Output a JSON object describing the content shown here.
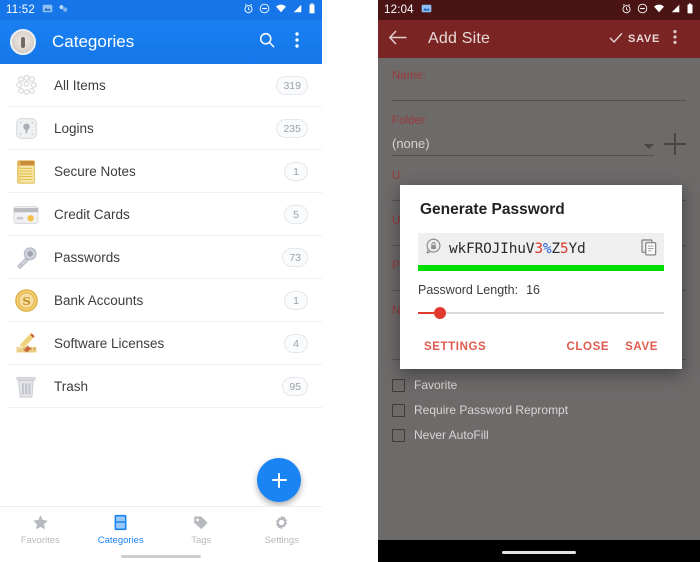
{
  "left_phone": {
    "status_bar": {
      "time": "11:52",
      "left_icons": [
        "screenshot-icon",
        "sync-icon"
      ],
      "right_icons": [
        "alarm-icon",
        "do-not-disturb-icon",
        "wifi-icon",
        "signal-icon",
        "battery-icon"
      ],
      "background": "#1675e8"
    },
    "app_bar": {
      "logo": "onepassword-logo-icon",
      "title": "Categories",
      "search_icon": "search-icon",
      "overflow_icon": "more-vertical-icon",
      "background": "#1a7cf0"
    },
    "categories": [
      {
        "icon": "all-items-icon",
        "label": "All Items",
        "count": "319"
      },
      {
        "icon": "logins-icon",
        "label": "Logins",
        "count": "235"
      },
      {
        "icon": "secure-notes-icon",
        "label": "Secure Notes",
        "count": "1"
      },
      {
        "icon": "credit-cards-icon",
        "label": "Credit Cards",
        "count": "5"
      },
      {
        "icon": "passwords-icon",
        "label": "Passwords",
        "count": "73"
      },
      {
        "icon": "bank-accounts-icon",
        "label": "Bank Accounts",
        "count": "1"
      },
      {
        "icon": "software-licenses-icon",
        "label": "Software Licenses",
        "count": "4"
      },
      {
        "icon": "trash-icon",
        "label": "Trash",
        "count": "95"
      }
    ],
    "fab": {
      "icon": "plus-icon",
      "color": "#1a84f5"
    },
    "bottom_nav": {
      "active": "Categories",
      "items": [
        {
          "icon": "star-icon",
          "label": "Favorites"
        },
        {
          "icon": "categories-icon",
          "label": "Categories"
        },
        {
          "icon": "tag-icon",
          "label": "Tags"
        },
        {
          "icon": "gear-icon",
          "label": "Settings"
        }
      ]
    }
  },
  "right_phone": {
    "status_bar": {
      "time": "12:04",
      "left_icons": [
        "screenshot-icon"
      ],
      "right_icons": [
        "alarm-icon",
        "do-not-disturb-icon",
        "wifi-icon",
        "signal-icon",
        "battery-icon"
      ],
      "background": "#4b1414"
    },
    "app_bar": {
      "back_icon": "back-arrow-icon",
      "title": "Add Site",
      "save_check_icon": "check-icon",
      "save_label": "SAVE",
      "overflow_icon": "more-vertical-icon",
      "background": "#7b2424"
    },
    "form": {
      "name": {
        "label": "Name:",
        "value": "",
        "placeholder": ""
      },
      "folder": {
        "label": "Folder:",
        "value": "(none)",
        "caret_icon": "chevron-down-icon",
        "add_icon": "plus-icon"
      },
      "username": {
        "label": "U"
      },
      "url": {
        "label": "U"
      },
      "password": {
        "label": "P"
      },
      "notes": {
        "label": "Notes:",
        "value": ""
      },
      "checkboxes": [
        {
          "label": "Favorite",
          "checked": false
        },
        {
          "label": "Require Password Reprompt",
          "checked": false
        },
        {
          "label": "Never AutoFill",
          "checked": false
        }
      ]
    },
    "dialog": {
      "title": "Generate Password",
      "regenerate_icon": "lock-refresh-icon",
      "copy_icon": "copy-icon",
      "password_segments": [
        {
          "text": "wkFROJIhuV",
          "kind": "letter"
        },
        {
          "text": "3",
          "kind": "digit"
        },
        {
          "text": "%",
          "kind": "symbol"
        },
        {
          "text": "Z",
          "kind": "letter"
        },
        {
          "text": "5",
          "kind": "digit"
        },
        {
          "text": "Yd",
          "kind": "letter"
        }
      ],
      "password_plain": "wkFROJIhuV3%Z5Yd",
      "strength_color": "#00dd00",
      "strength_percent": 100,
      "length_label": "Password Length:",
      "length_value": "16",
      "buttons": {
        "settings": "SETTINGS",
        "close": "CLOSE",
        "save": "SAVE"
      },
      "accent_color": "#e05a4e"
    }
  }
}
